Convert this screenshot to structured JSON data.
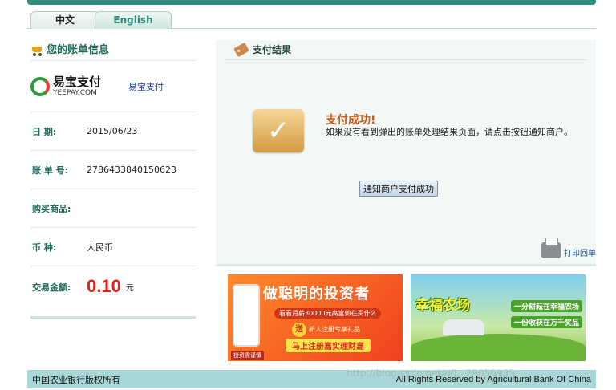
{
  "tabs": [
    {
      "label": "中文",
      "active": true
    },
    {
      "label": "English",
      "active": false
    }
  ],
  "bill": {
    "title": "您的账单信息",
    "brand_logo_cn": "易宝支付",
    "brand_logo_en": "YEEPAY.COM",
    "brand_name": "易宝支付",
    "date_label": "日 期:",
    "date_value": "2015/06/23",
    "order_label": "账 单 号:",
    "order_value": "2786433840150623",
    "goods_label": "购买商品:",
    "goods_value": "",
    "currency_label": "币 种:",
    "currency_value": "人民币",
    "amount_label": "交易金额:",
    "amount_value": "0.10",
    "amount_unit": "元"
  },
  "result": {
    "title": "支付结果",
    "success_title": "支付成功!",
    "success_desc": "如果没有看到弹出的账单处理结果页面，请点击按钮通知商户。",
    "notify_button": "通知商户支付成功",
    "print_label": "打印回单"
  },
  "ads": {
    "ad1_headline": "做聪明的投资者",
    "ad1_sub": "看看月薪30000元高富帅在买什么",
    "ad1_send_badge": "送",
    "ad1_send_text": "新人注册专享礼品",
    "ad1_cta": "马上注册嘉实理财嘉",
    "ad1_foot": "投资需谨慎",
    "ad2_headline": "幸福农场",
    "ad2_line1": "一分耕耘在幸福农场",
    "ad2_line2": "一份收获在万千奖品"
  },
  "footer": {
    "left": "中国农业银行版权所有",
    "right": "All Rights Reserved by Agricultural Bank Of China"
  },
  "watermark": "http://blog.csdn.net/u0...29056935",
  "colors": {
    "brand_green": "#2e8c7a",
    "amount_red": "#e0211b",
    "success_orange": "#c85a1a",
    "footer_bg": "#a9d6d6"
  }
}
